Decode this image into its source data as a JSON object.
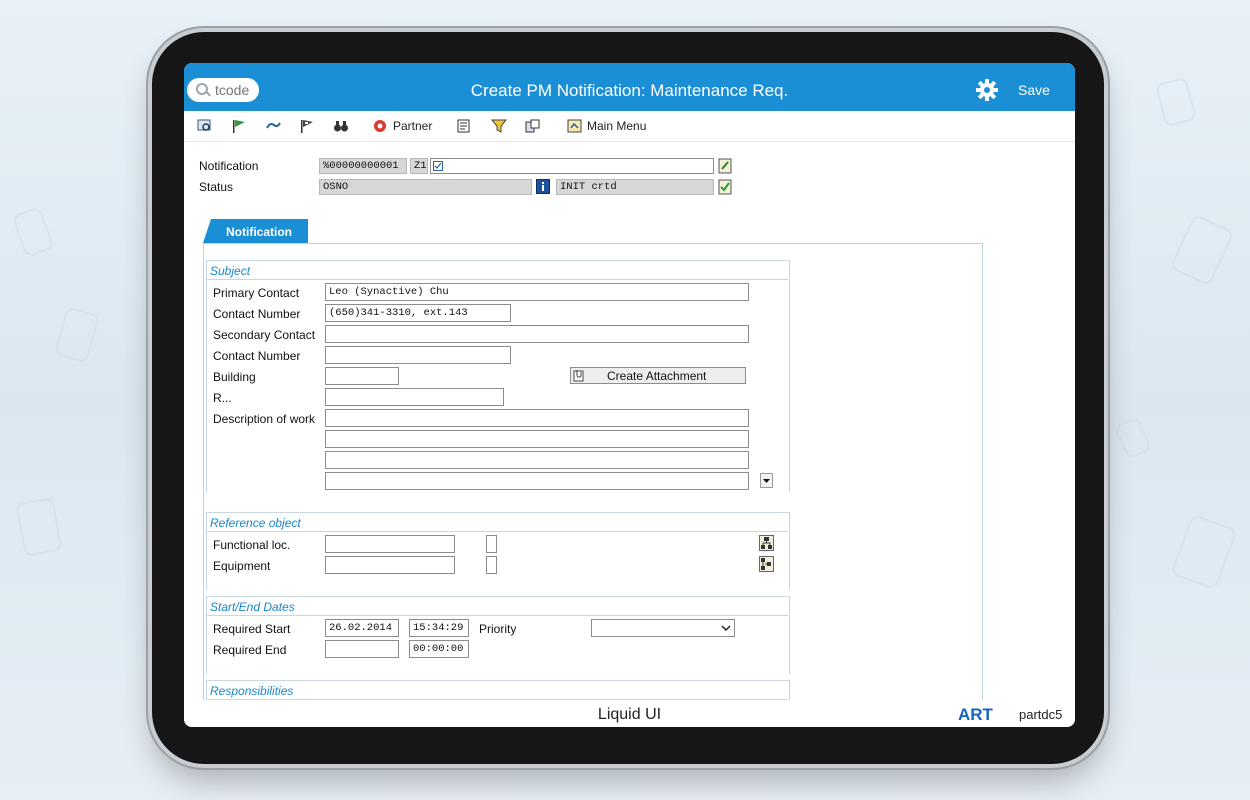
{
  "search": {
    "placeholder": "tcode"
  },
  "header": {
    "title": "Create PM Notification: Maintenance Req.",
    "save_label": "Save"
  },
  "toolbar": {
    "partner_label": "Partner",
    "main_menu_label": "Main Menu"
  },
  "top_fields": {
    "notification_label": "Notification",
    "notification_number": "%00000000001",
    "notification_type": "Z1",
    "status_label": "Status",
    "status_value": "OSNO",
    "status_text": "INIT crtd"
  },
  "tab": {
    "label": "Notification"
  },
  "subject": {
    "title": "Subject",
    "primary_contact_label": "Primary Contact",
    "primary_contact_value": "Leo (Synactive) Chu",
    "contact_number_label": "Contact Number",
    "contact_number_value": "(650)341-3310, ext.143",
    "secondary_contact_label": "Secondary Contact",
    "secondary_contact_value": "",
    "contact_number2_label": "Contact Number",
    "contact_number2_value": "",
    "building_label": "Building",
    "building_value": "",
    "room_label": "R...",
    "room_value": "",
    "description_label": "Description of work",
    "create_attachment_label": "Create Attachment"
  },
  "reference": {
    "title": "Reference object",
    "functional_loc_label": "Functional loc.",
    "equipment_label": "Equipment"
  },
  "dates": {
    "title": "Start/End Dates",
    "required_start_label": "Required Start",
    "required_start_date": "26.02.2014",
    "required_start_time": "15:34:29",
    "priority_label": "Priority",
    "priority_value": "",
    "required_end_label": "Required End",
    "required_end_date": "",
    "required_end_time": "00:00:00"
  },
  "responsibilities": {
    "title": "Responsibilities"
  },
  "footer": {
    "brand": "Liquid UI",
    "art_label": "ART",
    "server": "partdc5"
  },
  "colors": {
    "header_blue": "#1b8fd6",
    "group_title_blue": "#1b87cc",
    "art_blue": "#1565c0"
  }
}
